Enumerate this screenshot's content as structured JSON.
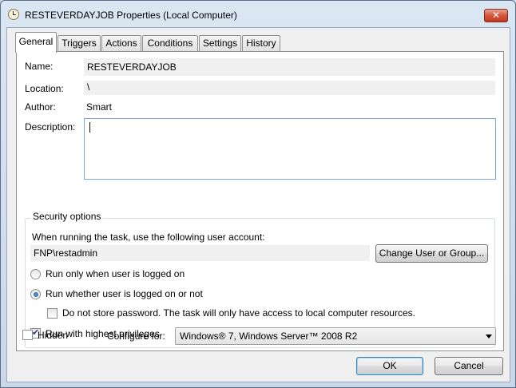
{
  "window": {
    "title": "RESTEVERDAYJOB Properties (Local Computer)",
    "close_label": "✕"
  },
  "tabs": [
    {
      "label": "General",
      "active": true
    },
    {
      "label": "Triggers",
      "active": false
    },
    {
      "label": "Actions",
      "active": false
    },
    {
      "label": "Conditions",
      "active": false
    },
    {
      "label": "Settings",
      "active": false
    },
    {
      "label": "History",
      "active": false
    }
  ],
  "general": {
    "name_label": "Name:",
    "name_value": "RESTEVERDAYJOB",
    "location_label": "Location:",
    "location_value": "\\",
    "author_label": "Author:",
    "author_value": "Smart",
    "description_label": "Description:",
    "description_value": ""
  },
  "security": {
    "title": "Security options",
    "account_prompt": "When running the task, use the following user account:",
    "account_value": "FNP\\restadmin",
    "change_button": "Change User or Group...",
    "radio_logged_on": "Run only when user is logged on",
    "radio_whether": "Run whether user is logged on or not",
    "radio_selected": "whether",
    "no_store_password": "Do not store password.  The task will only have access to local computer resources.",
    "no_store_password_checked": false,
    "highest_privileges": "Run with highest privileges",
    "highest_privileges_checked": true
  },
  "bottom": {
    "hidden_label": "Hidden",
    "hidden_checked": false,
    "configure_label": "Configure for:",
    "configure_value": "Windows® 7, Windows Server™ 2008 R2"
  },
  "buttons": {
    "ok": "OK",
    "cancel": "Cancel"
  },
  "colors": {
    "title_bar": "#c9d7e9",
    "close_button": "#c23b22",
    "focus_border": "#7aa7d8",
    "default_button_border": "#3c7fb1"
  }
}
